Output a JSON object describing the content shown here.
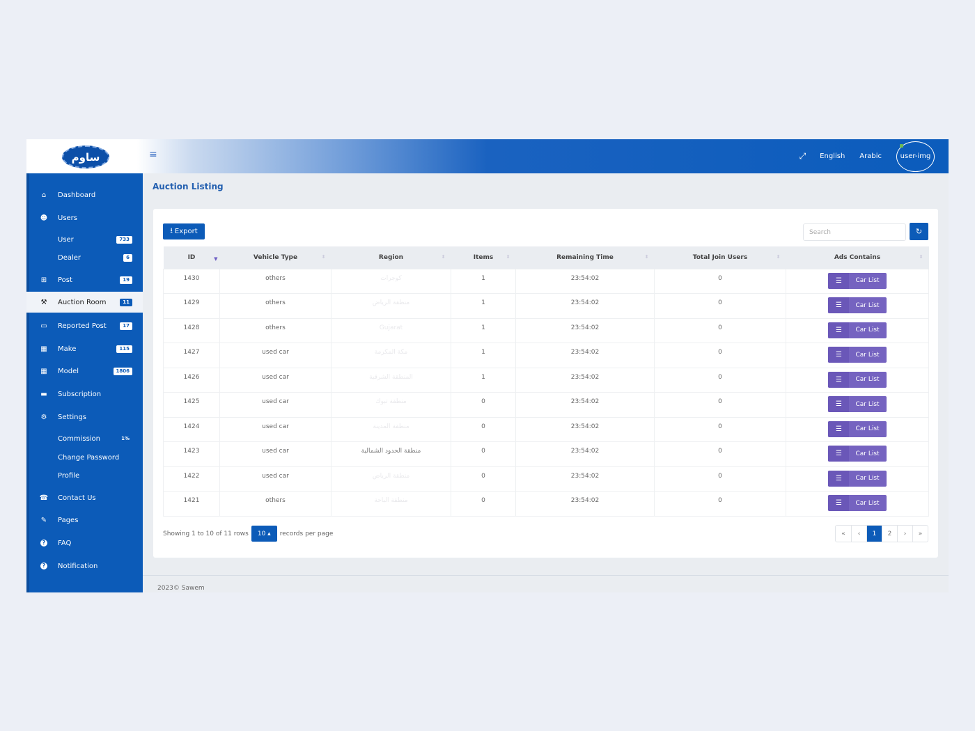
{
  "header": {
    "logo_text": "ساوم",
    "menu_icon": "hamburger-icon",
    "fullscreen_icon": "fullscreen-icon",
    "lang_english": "English",
    "lang_arabic": "Arabic",
    "avatar_alt": "user-img"
  },
  "sidebar": {
    "items": [
      {
        "label": "Dashboard",
        "icon": "home-icon"
      },
      {
        "label": "Users",
        "icon": "users-icon"
      },
      {
        "label": "User",
        "badge": "733"
      },
      {
        "label": "Dealer",
        "badge": "6"
      },
      {
        "label": "Post",
        "icon": "grid-icon",
        "badge": "19"
      },
      {
        "label": "Auction Room",
        "icon": "gavel-icon",
        "badge": "11"
      },
      {
        "label": "Reported Post",
        "icon": "inbox-icon",
        "badge": "17"
      },
      {
        "label": "Make",
        "icon": "table-icon",
        "badge": "115"
      },
      {
        "label": "Model",
        "icon": "table-icon",
        "badge": "1806"
      },
      {
        "label": "Subscription",
        "icon": "credit-card-icon"
      },
      {
        "label": "Settings",
        "icon": "gear-icon"
      },
      {
        "label": "Commission",
        "badge": "1%"
      },
      {
        "label": "Change Password"
      },
      {
        "label": "Profile"
      },
      {
        "label": "Contact Us",
        "icon": "phone-icon"
      },
      {
        "label": "Pages",
        "icon": "edit-icon"
      },
      {
        "label": "FAQ",
        "icon": "question-icon"
      },
      {
        "label": "Notification",
        "icon": "question-icon"
      }
    ],
    "active": "Auction Room"
  },
  "main": {
    "page_title": "Auction Listing",
    "export_label": "Export",
    "search_placeholder": "Search",
    "table": {
      "columns": [
        "ID",
        "Vehicle Type",
        "Region",
        "Items",
        "Remaining Time",
        "Total Join Users",
        "Ads Contains"
      ],
      "rows": [
        {
          "id": "1430",
          "vehicle_type": "others",
          "region": "كوجرات",
          "items": "1",
          "remaining": "23:54:02",
          "joined": "0",
          "action": "Car List"
        },
        {
          "id": "1429",
          "vehicle_type": "others",
          "region": "منطقة الرياض",
          "items": "1",
          "remaining": "23:54:02",
          "joined": "0",
          "action": "Car List"
        },
        {
          "id": "1428",
          "vehicle_type": "others",
          "region": "Gujarat",
          "items": "1",
          "remaining": "23:54:02",
          "joined": "0",
          "action": "Car List"
        },
        {
          "id": "1427",
          "vehicle_type": "used car",
          "region": "مكة المكرمة",
          "items": "1",
          "remaining": "23:54:02",
          "joined": "0",
          "action": "Car List"
        },
        {
          "id": "1426",
          "vehicle_type": "used car",
          "region": "المنطقة الشرقية",
          "items": "1",
          "remaining": "23:54:02",
          "joined": "0",
          "action": "Car List"
        },
        {
          "id": "1425",
          "vehicle_type": "used car",
          "region": "منطقة تبوك",
          "items": "0",
          "remaining": "23:54:02",
          "joined": "0",
          "action": "Car List"
        },
        {
          "id": "1424",
          "vehicle_type": "used car",
          "region": "منطقة المدينة",
          "items": "0",
          "remaining": "23:54:02",
          "joined": "0",
          "action": "Car List"
        },
        {
          "id": "1423",
          "vehicle_type": "used car",
          "region": "منطقة الحدود الشمالية",
          "items": "0",
          "remaining": "23:54:02",
          "joined": "0",
          "action": "Car List"
        },
        {
          "id": "1422",
          "vehicle_type": "used car",
          "region": "منطقة الرياض",
          "items": "0",
          "remaining": "23:54:02",
          "joined": "0",
          "action": "Car List"
        },
        {
          "id": "1421",
          "vehicle_type": "others",
          "region": "منطقة الباحة",
          "items": "0",
          "remaining": "23:54:02",
          "joined": "0",
          "action": "Car List"
        }
      ]
    },
    "pagination": {
      "showing_text": "Showing 1 to 10 of 11 rows",
      "per_page_value": "10 ▴",
      "per_page_suffix": "records per page",
      "pages": [
        "«",
        "‹",
        "1",
        "2",
        "›",
        "»"
      ],
      "current_page": "1"
    }
  },
  "footer": {
    "copyright": "2023© Sawem"
  }
}
